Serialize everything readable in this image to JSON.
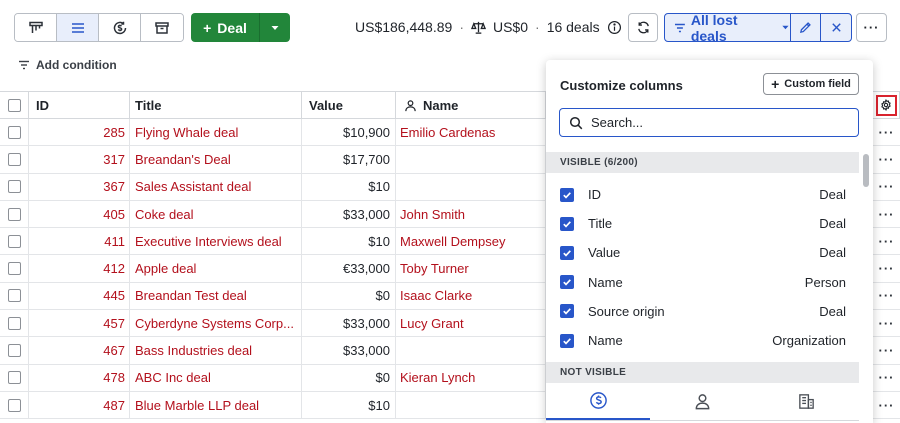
{
  "toolbar": {
    "views": [
      {
        "icon": "pipeline-view-icon",
        "active": false
      },
      {
        "icon": "list-view-icon",
        "active": true
      },
      {
        "icon": "forecast-view-icon",
        "active": false
      },
      {
        "icon": "archive-view-icon",
        "active": false
      }
    ],
    "add_deal_label": "Deal",
    "summary": {
      "total": "US$186,448.89",
      "weighted": "US$0",
      "count": "16 deals"
    },
    "filter_label": "All lost deals"
  },
  "add_condition_label": "Add condition",
  "table": {
    "columns": {
      "id": "ID",
      "title": "Title",
      "value": "Value",
      "name": "Name"
    },
    "rows": [
      {
        "id": "285",
        "title": "Flying Whale deal",
        "value": "$10,900",
        "name": "Emilio Cardenas"
      },
      {
        "id": "317",
        "title": "Breandan's Deal",
        "value": "$17,700",
        "name": ""
      },
      {
        "id": "367",
        "title": "Sales Assistant deal",
        "value": "$10",
        "name": ""
      },
      {
        "id": "405",
        "title": "Coke deal",
        "value": "$33,000",
        "name": "John Smith"
      },
      {
        "id": "411",
        "title": "Executive Interviews deal",
        "value": "$10",
        "name": "Maxwell Dempsey"
      },
      {
        "id": "412",
        "title": "Apple deal",
        "value": "€33,000",
        "name": "Toby Turner"
      },
      {
        "id": "445",
        "title": "Breandan Test deal",
        "value": "$0",
        "name": "Isaac Clarke"
      },
      {
        "id": "457",
        "title": "Cyberdyne Systems Corp...",
        "value": "$33,000",
        "name": "Lucy Grant"
      },
      {
        "id": "467",
        "title": "Bass Industries deal",
        "value": "$33,000",
        "name": ""
      },
      {
        "id": "478",
        "title": "ABC Inc deal",
        "value": "$0",
        "name": "Kieran Lynch"
      },
      {
        "id": "487",
        "title": "Blue Marble LLP deal",
        "value": "$10",
        "name": ""
      }
    ]
  },
  "panel": {
    "title": "Customize columns",
    "custom_field_label": "Custom field",
    "search_placeholder": "Search...",
    "visible_header": "VISIBLE (6/200)",
    "visible_columns": [
      {
        "label": "ID",
        "type": "Deal"
      },
      {
        "label": "Title",
        "type": "Deal"
      },
      {
        "label": "Value",
        "type": "Deal"
      },
      {
        "label": "Name",
        "type": "Person"
      },
      {
        "label": "Source origin",
        "type": "Deal"
      },
      {
        "label": "Name",
        "type": "Organization"
      }
    ],
    "not_visible_header": "NOT VISIBLE",
    "tabs": [
      {
        "icon": "deal-dollar-icon",
        "active": true
      },
      {
        "icon": "person-icon",
        "active": false
      },
      {
        "icon": "organization-icon",
        "active": false
      }
    ]
  },
  "colors": {
    "accent": "#2856c9",
    "deal_green": "#22863a",
    "link_red": "#b3101c",
    "highlight_red": "#d9232e"
  }
}
